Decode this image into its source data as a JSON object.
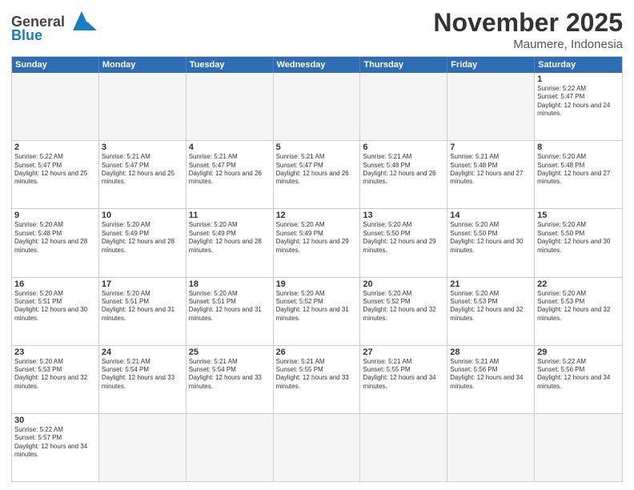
{
  "header": {
    "logo_general": "General",
    "logo_blue": "Blue",
    "month_title": "November 2025",
    "location": "Maumere, Indonesia"
  },
  "days": [
    "Sunday",
    "Monday",
    "Tuesday",
    "Wednesday",
    "Thursday",
    "Friday",
    "Saturday"
  ],
  "weeks": [
    [
      {
        "day": "",
        "empty": true
      },
      {
        "day": "",
        "empty": true
      },
      {
        "day": "",
        "empty": true
      },
      {
        "day": "",
        "empty": true
      },
      {
        "day": "",
        "empty": true
      },
      {
        "day": "",
        "empty": true
      },
      {
        "day": "1",
        "sunrise": "5:22 AM",
        "sunset": "5:47 PM",
        "daylight": "12 hours and 24 minutes."
      }
    ],
    [
      {
        "day": "2",
        "sunrise": "5:22 AM",
        "sunset": "5:47 PM",
        "daylight": "12 hours and 25 minutes."
      },
      {
        "day": "3",
        "sunrise": "5:21 AM",
        "sunset": "5:47 PM",
        "daylight": "12 hours and 25 minutes."
      },
      {
        "day": "4",
        "sunrise": "5:21 AM",
        "sunset": "5:47 PM",
        "daylight": "12 hours and 26 minutes."
      },
      {
        "day": "5",
        "sunrise": "5:21 AM",
        "sunset": "5:47 PM",
        "daylight": "12 hours and 26 minutes."
      },
      {
        "day": "6",
        "sunrise": "5:21 AM",
        "sunset": "5:48 PM",
        "daylight": "12 hours and 26 minutes."
      },
      {
        "day": "7",
        "sunrise": "5:21 AM",
        "sunset": "5:48 PM",
        "daylight": "12 hours and 27 minutes."
      },
      {
        "day": "8",
        "sunrise": "5:20 AM",
        "sunset": "5:48 PM",
        "daylight": "12 hours and 27 minutes."
      }
    ],
    [
      {
        "day": "9",
        "sunrise": "5:20 AM",
        "sunset": "5:48 PM",
        "daylight": "12 hours and 28 minutes."
      },
      {
        "day": "10",
        "sunrise": "5:20 AM",
        "sunset": "5:49 PM",
        "daylight": "12 hours and 28 minutes."
      },
      {
        "day": "11",
        "sunrise": "5:20 AM",
        "sunset": "5:49 PM",
        "daylight": "12 hours and 28 minutes."
      },
      {
        "day": "12",
        "sunrise": "5:20 AM",
        "sunset": "5:49 PM",
        "daylight": "12 hours and 29 minutes."
      },
      {
        "day": "13",
        "sunrise": "5:20 AM",
        "sunset": "5:50 PM",
        "daylight": "12 hours and 29 minutes."
      },
      {
        "day": "14",
        "sunrise": "5:20 AM",
        "sunset": "5:50 PM",
        "daylight": "12 hours and 30 minutes."
      },
      {
        "day": "15",
        "sunrise": "5:20 AM",
        "sunset": "5:50 PM",
        "daylight": "12 hours and 30 minutes."
      }
    ],
    [
      {
        "day": "16",
        "sunrise": "5:20 AM",
        "sunset": "5:51 PM",
        "daylight": "12 hours and 30 minutes."
      },
      {
        "day": "17",
        "sunrise": "5:20 AM",
        "sunset": "5:51 PM",
        "daylight": "12 hours and 31 minutes."
      },
      {
        "day": "18",
        "sunrise": "5:20 AM",
        "sunset": "5:51 PM",
        "daylight": "12 hours and 31 minutes."
      },
      {
        "day": "19",
        "sunrise": "5:20 AM",
        "sunset": "5:52 PM",
        "daylight": "12 hours and 31 minutes."
      },
      {
        "day": "20",
        "sunrise": "5:20 AM",
        "sunset": "5:52 PM",
        "daylight": "12 hours and 32 minutes."
      },
      {
        "day": "21",
        "sunrise": "5:20 AM",
        "sunset": "5:53 PM",
        "daylight": "12 hours and 32 minutes."
      },
      {
        "day": "22",
        "sunrise": "5:20 AM",
        "sunset": "5:53 PM",
        "daylight": "12 hours and 32 minutes."
      }
    ],
    [
      {
        "day": "23",
        "sunrise": "5:20 AM",
        "sunset": "5:53 PM",
        "daylight": "12 hours and 32 minutes."
      },
      {
        "day": "24",
        "sunrise": "5:21 AM",
        "sunset": "5:54 PM",
        "daylight": "12 hours and 33 minutes."
      },
      {
        "day": "25",
        "sunrise": "5:21 AM",
        "sunset": "5:54 PM",
        "daylight": "12 hours and 33 minutes."
      },
      {
        "day": "26",
        "sunrise": "5:21 AM",
        "sunset": "5:55 PM",
        "daylight": "12 hours and 33 minutes."
      },
      {
        "day": "27",
        "sunrise": "5:21 AM",
        "sunset": "5:55 PM",
        "daylight": "12 hours and 34 minutes."
      },
      {
        "day": "28",
        "sunrise": "5:21 AM",
        "sunset": "5:56 PM",
        "daylight": "12 hours and 34 minutes."
      },
      {
        "day": "29",
        "sunrise": "5:22 AM",
        "sunset": "5:56 PM",
        "daylight": "12 hours and 34 minutes."
      }
    ],
    [
      {
        "day": "30",
        "sunrise": "5:22 AM",
        "sunset": "5:57 PM",
        "daylight": "12 hours and 34 minutes."
      },
      {
        "day": "",
        "empty": true
      },
      {
        "day": "",
        "empty": true
      },
      {
        "day": "",
        "empty": true
      },
      {
        "day": "",
        "empty": true
      },
      {
        "day": "",
        "empty": true
      },
      {
        "day": "",
        "empty": true
      }
    ]
  ],
  "labels": {
    "sunrise": "Sunrise: ",
    "sunset": "Sunset: ",
    "daylight": "Daylight: "
  }
}
